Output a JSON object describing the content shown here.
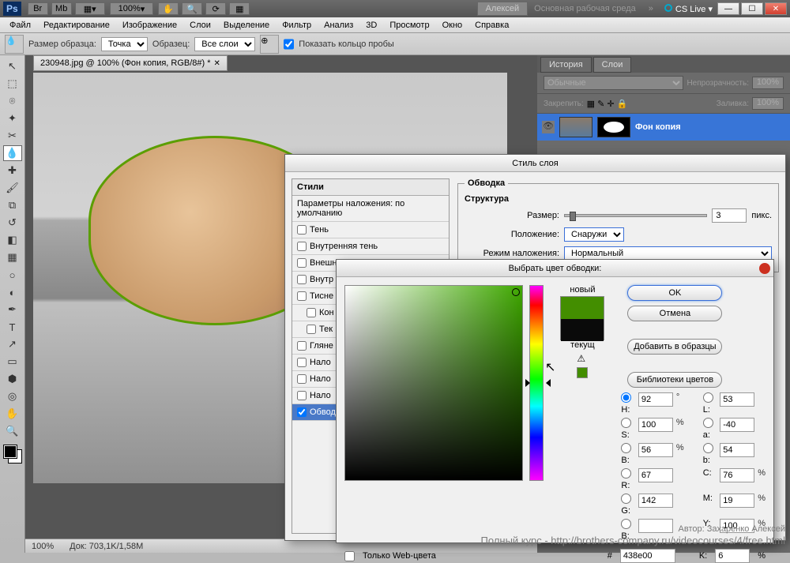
{
  "titlebar": {
    "user": "Алексей",
    "workspace": "Основная рабочая среда",
    "cs": "CS Live",
    "zoom": "100%"
  },
  "menu": [
    "Файл",
    "Редактирование",
    "Изображение",
    "Слои",
    "Выделение",
    "Фильтр",
    "Анализ",
    "3D",
    "Просмотр",
    "Окно",
    "Справка"
  ],
  "opt": {
    "size": "Размер образца:",
    "size_v": "Точка",
    "sample": "Образец:",
    "sample_v": "Все слои",
    "ring": "Показать кольцо пробы"
  },
  "doc": {
    "tab": "230948.jpg @ 100% (Фон копия, RGB/8#) *",
    "zoom": "100%",
    "info": "Док: 703,1K/1,58M"
  },
  "panels": {
    "tabs": [
      "История",
      "Слои"
    ],
    "mode": "Обычные",
    "opacity_l": "Непрозрачность:",
    "opacity": "100%",
    "fill_l": "Заливка:",
    "fill": "100%",
    "layer": "Фон копия"
  },
  "ls": {
    "title": "Стиль слоя",
    "styles": "Стили",
    "defaults": "Параметры наложения: по умолчанию",
    "items": [
      "Тень",
      "Внутренняя тень",
      "Внешн",
      "Внутр",
      "Тисне",
      "Кон",
      "Тек",
      "Гляне",
      "Нало",
      "Нало",
      "Нало",
      "Обвод"
    ],
    "check": [
      false,
      false,
      false,
      false,
      false,
      false,
      false,
      false,
      false,
      false,
      false,
      true
    ],
    "group": "Обводка",
    "struct": "Структура",
    "size_l": "Размер:",
    "size_v": "3",
    "size_u": "пикс.",
    "pos_l": "Положение:",
    "pos_v": "Снаружи",
    "blend_l": "Режим наложения:",
    "blend_v": "Нормальный"
  },
  "cp": {
    "title": "Выбрать цвет обводки:",
    "new": "новый",
    "cur": "текущ",
    "ok": "OK",
    "cancel": "Отмена",
    "add": "Добавить в образцы",
    "lib": "Библиотеки цветов",
    "H": "92",
    "S": "100",
    "Bv": "56",
    "R": "67",
    "G": "142",
    "B": "",
    "L": "53",
    "a": "-40",
    "b": "54",
    "C": "76",
    "M": "19",
    "Y": "100",
    "K": "6",
    "hex": "438e00",
    "web": "Только Web-цвета"
  },
  "wm": {
    "l1": "Автор: Захаренко Алексей",
    "l2": "Полный курс - http://brothers-company.ru/videocourses/4/free.html"
  }
}
